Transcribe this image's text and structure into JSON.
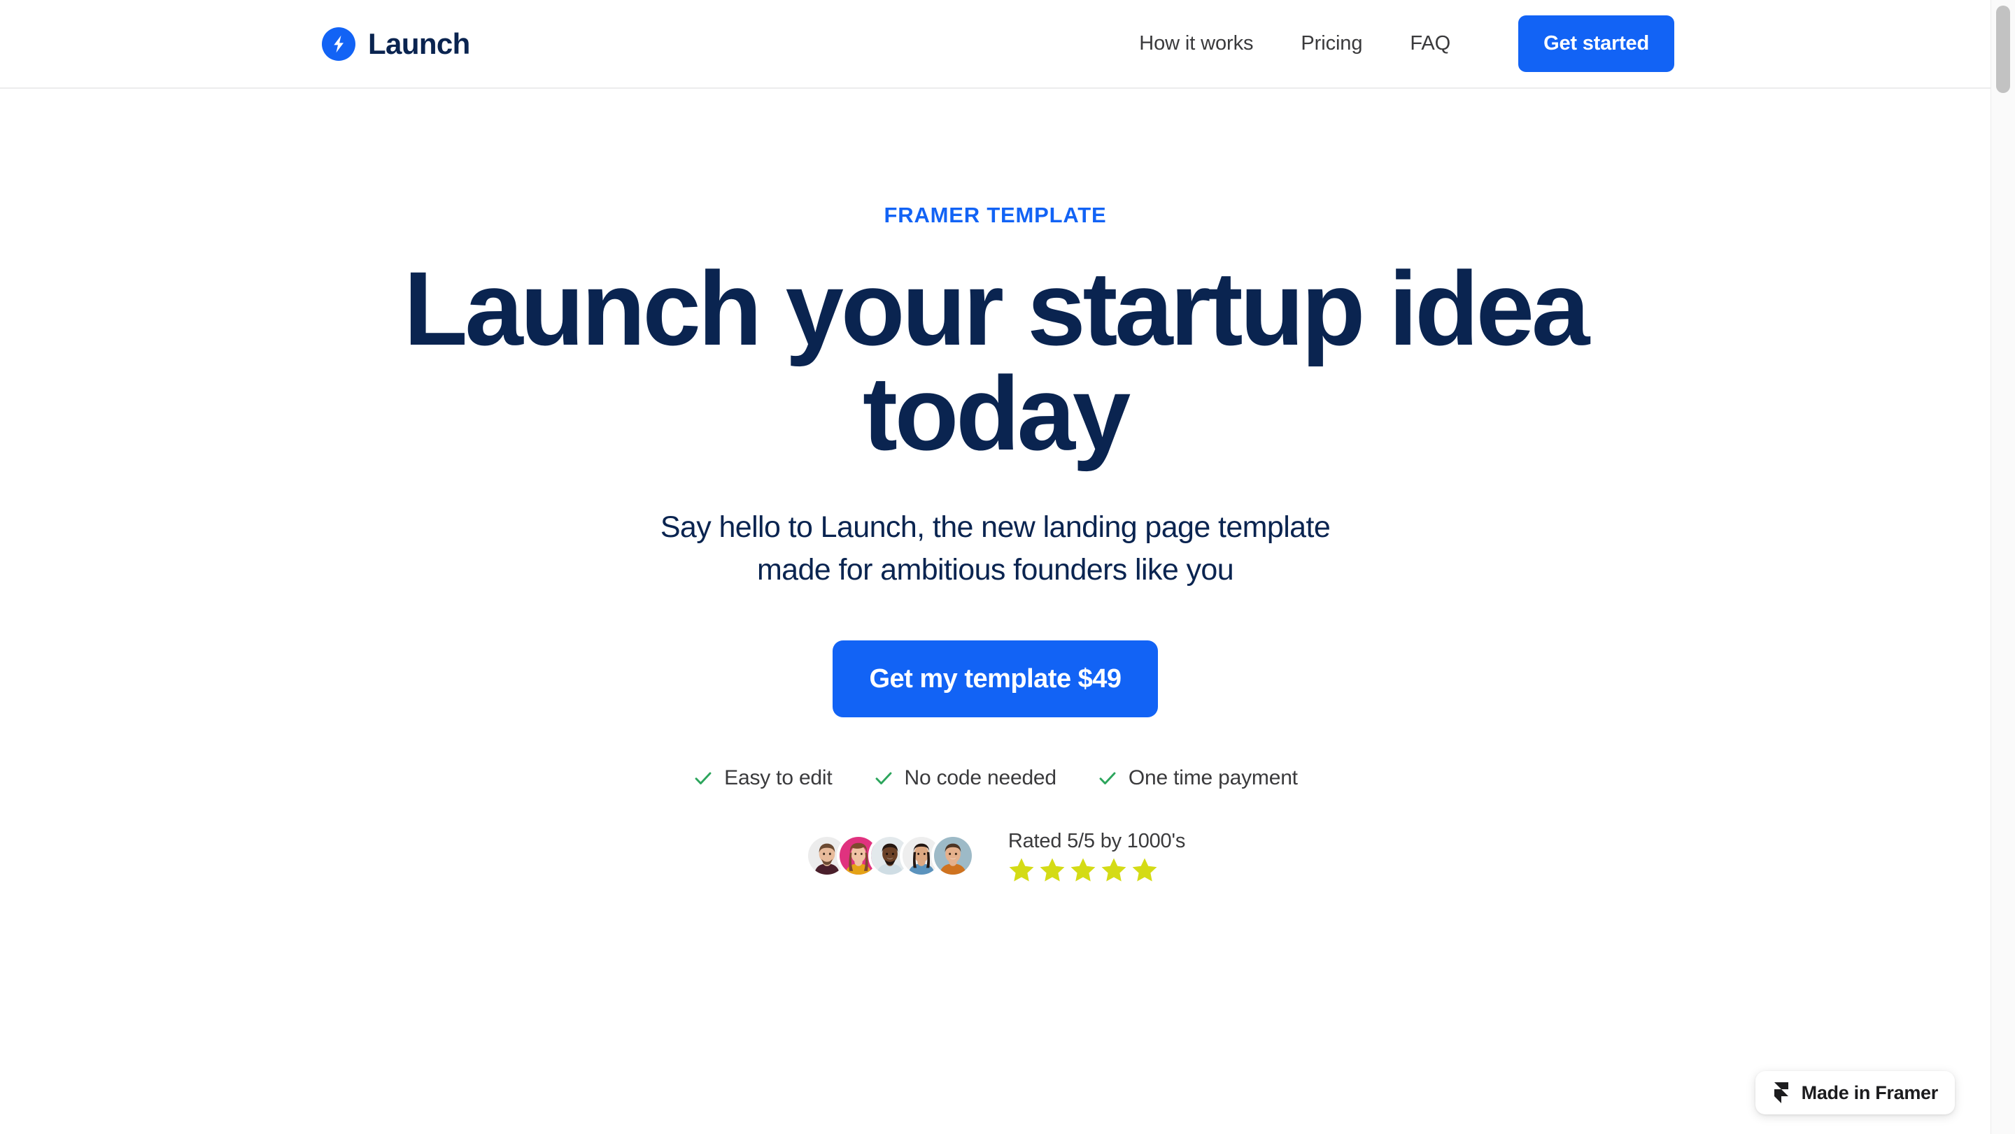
{
  "brand": {
    "name": "Launch",
    "logo_icon": "lightning-bolt-icon",
    "logo_color": "#1263f5"
  },
  "nav": {
    "links": [
      {
        "label": "How it works"
      },
      {
        "label": "Pricing"
      },
      {
        "label": "FAQ"
      }
    ],
    "cta_label": "Get started",
    "cta_color": "#1263f5"
  },
  "hero": {
    "eyebrow": "FRAMER TEMPLATE",
    "eyebrow_color": "#1263f5",
    "headline": "Launch your startup idea today",
    "headline_color": "#0a2450",
    "subhead_line1": "Say hello to Launch, the new landing page template",
    "subhead_line2": "made for ambitious founders like you",
    "cta_label": "Get my template $49",
    "cta_color": "#1263f5"
  },
  "features": {
    "check_icon": "check-icon",
    "check_color": "#2ca55c",
    "items": [
      {
        "label": "Easy to edit"
      },
      {
        "label": "No code needed"
      },
      {
        "label": "One time payment"
      }
    ]
  },
  "social_proof": {
    "rating_text": "Rated 5/5 by 1000's",
    "star_icon": "star-icon",
    "star_color": "#d4db16",
    "star_count": 5,
    "avatars": [
      {
        "name": "avatar-1",
        "bg": "#ececec",
        "skin": "#e8bb9b",
        "hair": "#6b4a32",
        "shirt": "#4a1f2b"
      },
      {
        "name": "avatar-2",
        "bg": "#e0327f",
        "skin": "#f0c3a4",
        "hair": "#7d4a2e",
        "shirt": "#e5a316"
      },
      {
        "name": "avatar-3",
        "bg": "#e3e9ec",
        "skin": "#6b4127",
        "hair": "#241610",
        "shirt": "#cfdde4"
      },
      {
        "name": "avatar-4",
        "bg": "#eeeeee",
        "skin": "#dda882",
        "hair": "#231611",
        "shirt": "#5b93bd"
      },
      {
        "name": "avatar-5",
        "bg": "#9dbac7",
        "skin": "#e5b08c",
        "hair": "#4d3525",
        "shirt": "#cf7320"
      }
    ]
  },
  "framer_badge": {
    "label": "Made in Framer",
    "icon": "framer-logo-icon"
  },
  "scrollbar": {
    "name": "page-scrollbar"
  }
}
